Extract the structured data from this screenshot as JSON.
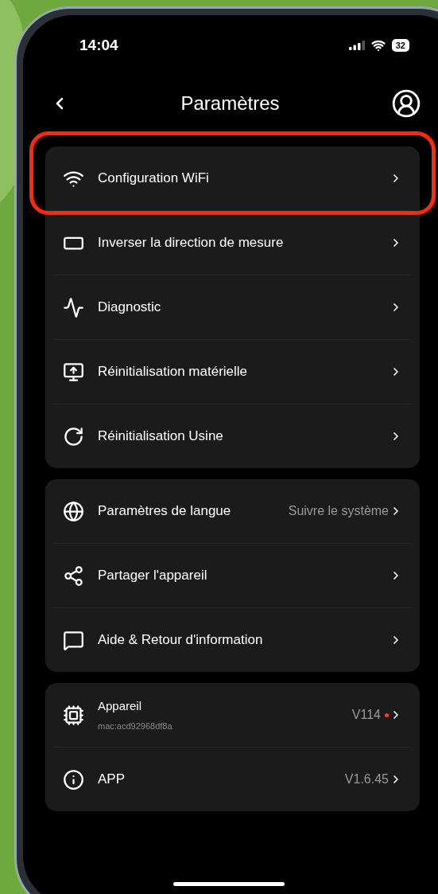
{
  "status_bar": {
    "time": "14:04",
    "battery": "32"
  },
  "header": {
    "title": "Paramètres"
  },
  "groups": [
    {
      "rows": [
        {
          "label": "Configuration WiFi",
          "highlighted": true
        },
        {
          "label": "Inverser la direction de mesure",
          "highlighted": false
        },
        {
          "label": "Diagnostic",
          "highlighted": false
        },
        {
          "label": "Réinitialisation matérielle",
          "highlighted": false
        },
        {
          "label": "Réinitialisation Usine",
          "highlighted": false
        }
      ]
    },
    {
      "rows": [
        {
          "label": "Paramètres de langue",
          "value": "Suivre le système",
          "highlighted": false
        },
        {
          "label": "Partager l'appareil",
          "highlighted": false
        },
        {
          "label": "Aide & Retour d'information",
          "highlighted": false
        }
      ]
    },
    {
      "rows": [
        {
          "label": "Appareil",
          "subtitle": "mac:acd92968df8a",
          "value": "V114",
          "update_dot": true,
          "highlighted": false
        },
        {
          "label": "APP",
          "value": "V1.6.45",
          "update_dot": false,
          "highlighted": false
        }
      ]
    }
  ]
}
